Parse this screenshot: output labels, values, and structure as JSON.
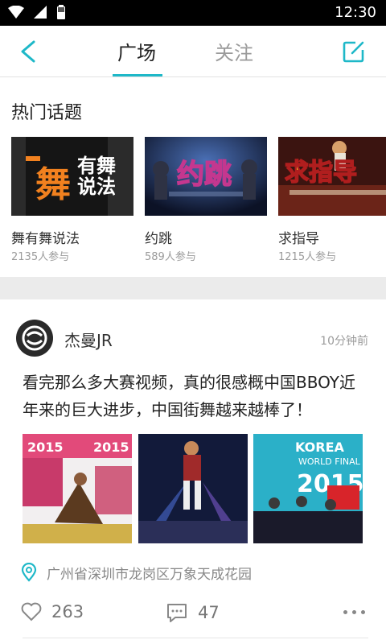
{
  "status_bar": {
    "time": "12:30"
  },
  "nav": {
    "tabs": [
      {
        "label": "广场",
        "active": true
      },
      {
        "label": "关注",
        "active": false
      }
    ],
    "accent_color": "#1eb8c8"
  },
  "hot_topics": {
    "title": "热门话题",
    "items": [
      {
        "name": "舞有舞说法",
        "count": "2135人参与",
        "thumb_text_1": "舞",
        "thumb_text_2": "有舞",
        "thumb_text_3": "说法"
      },
      {
        "name": "约跳",
        "count": "589人参与",
        "thumb_text_1": "约跳"
      },
      {
        "name": "求指导",
        "count": "1215人参与",
        "thumb_text_1": "求指导"
      }
    ]
  },
  "post": {
    "author": "杰曼JR",
    "time": "10分钟前",
    "text": "看完那么多大赛视频，真的很感概中国BBOY近年来的巨大进步，中国街舞越来越棒了！",
    "images": [
      {
        "caption_a": "2015",
        "caption_b": "2015"
      },
      {
        "caption_a": ""
      },
      {
        "caption_a": "KOREA",
        "caption_b": "WORLD FINAL",
        "caption_c": "2015"
      }
    ],
    "location": "广州省深圳市龙岗区万象天成花园",
    "likes": "263",
    "comments": "47"
  }
}
